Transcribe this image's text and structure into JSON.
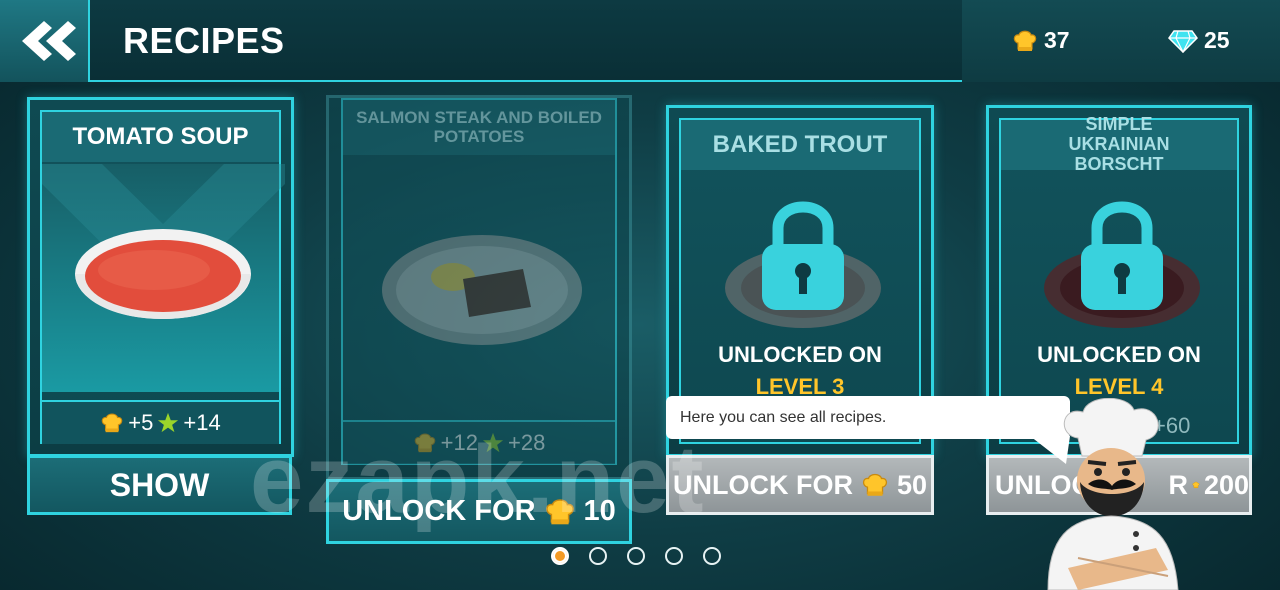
{
  "header": {
    "title": "RECIPES",
    "hats": "37",
    "gems": "25"
  },
  "cards": [
    {
      "title": "TOMATO SOUP",
      "reward_hats": "+5",
      "reward_stars": "+14",
      "button": "SHOW"
    },
    {
      "title": "SALMON STEAK AND BOILED POTATOES",
      "reward_hats": "+12",
      "reward_stars": "+28",
      "button_text": "UNLOCK FOR",
      "price": "10"
    },
    {
      "title": "BAKED TROUT",
      "unlock_label": "UNLOCKED ON",
      "level": "LEVEL 3",
      "button_text": "UNLOCK FOR",
      "price": "50"
    },
    {
      "title": "SIMPLE UKRAINIAN BORSCHT",
      "unlock_label": "UNLOCKED ON",
      "level": "LEVEL 4",
      "reward_stars": "+60",
      "button_text": "UNLOCK",
      "button_text_tail": "R",
      "price": "200"
    }
  ],
  "tooltip": "Here you can see all recipes.",
  "watermark": "ezapk.net",
  "pagination": {
    "total": 5,
    "active": 0
  },
  "colors": {
    "accent": "#2fd3e0",
    "gold": "#ffc52a",
    "active_dot": "#f39a24"
  }
}
